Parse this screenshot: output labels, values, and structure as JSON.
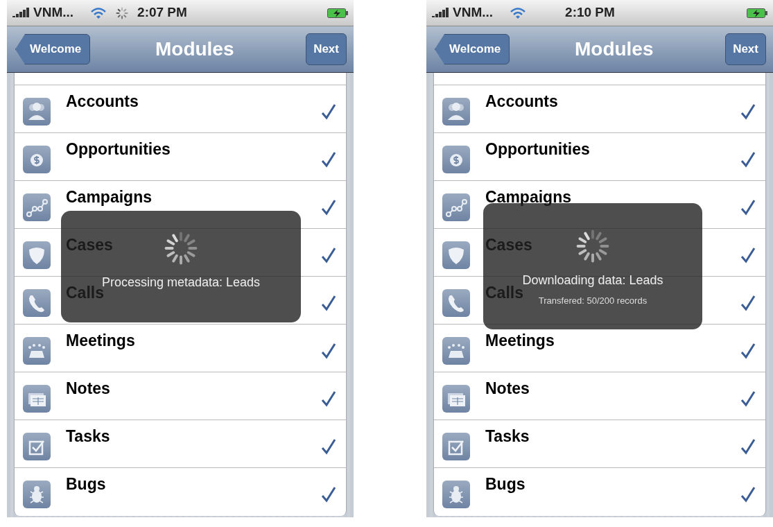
{
  "phones": [
    {
      "status_bar": {
        "carrier": "VNM...",
        "time": "2:07 PM",
        "network_activity": true
      },
      "nav_bar": {
        "back": "Welcome",
        "title": "Modules",
        "next": "Next"
      },
      "modules": [
        {
          "name": "Accounts",
          "checked": true
        },
        {
          "name": "Opportunities",
          "checked": true
        },
        {
          "name": "Campaigns",
          "checked": true
        },
        {
          "name": "Cases",
          "checked": true
        },
        {
          "name": "Calls",
          "checked": true
        },
        {
          "name": "Meetings",
          "checked": true
        },
        {
          "name": "Notes",
          "checked": true
        },
        {
          "name": "Tasks",
          "checked": true
        },
        {
          "name": "Bugs",
          "checked": true
        }
      ],
      "progress_overlay": {
        "message": "Processing metadata: Leads"
      }
    },
    {
      "status_bar": {
        "carrier": "VNM...",
        "time": "2:10 PM",
        "network_activity": false
      },
      "nav_bar": {
        "back": "Welcome",
        "title": "Modules",
        "next": "Next"
      },
      "modules": [
        {
          "name": "Accounts",
          "checked": true
        },
        {
          "name": "Opportunities",
          "checked": true
        },
        {
          "name": "Campaigns",
          "checked": true
        },
        {
          "name": "Cases",
          "checked": true
        },
        {
          "name": "Calls",
          "checked": true
        },
        {
          "name": "Meetings",
          "checked": true
        },
        {
          "name": "Notes",
          "checked": true
        },
        {
          "name": "Tasks",
          "checked": true
        },
        {
          "name": "Bugs",
          "checked": true
        }
      ],
      "progress_overlay": {
        "message": "Downloading data: Leads",
        "detail": "Transfered: 50/200 records"
      }
    }
  ]
}
